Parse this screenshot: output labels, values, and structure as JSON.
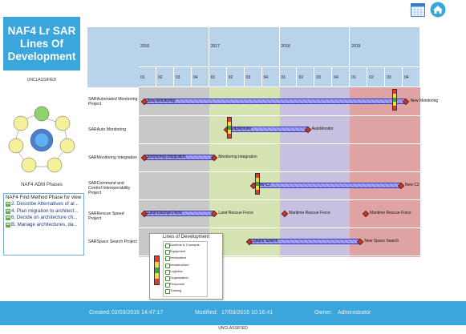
{
  "header": {
    "title_lines": [
      "NAF4 Lr SAR",
      "Lines Of",
      "Development"
    ],
    "classification": "UNCLASSIFIED",
    "icons": [
      "calendar-icon",
      "home-icon"
    ]
  },
  "adm": {
    "caption": "NAF4 ADM Phases"
  },
  "phase_list": {
    "title": "NAF4 Find Method Phase for view",
    "items": [
      "2. Describe Alternatives of ar...",
      "4. Plan migration to architect...",
      "6. Decide on architecture ch...",
      "B. Manage architectures, da..."
    ]
  },
  "timeline": {
    "years": [
      "2016",
      "2017",
      "2018",
      "2019"
    ],
    "quarters": [
      "01",
      "02",
      "03",
      "04",
      "01",
      "02",
      "03",
      "04",
      "01",
      "02",
      "03",
      "04",
      "01",
      "02",
      "03",
      "04"
    ],
    "rows": [
      {
        "label": "SARAutomated Monitoring Project"
      },
      {
        "label": "SARAuto Monitoring"
      },
      {
        "label": "SARMonitoring Integration"
      },
      {
        "label": "SARCommand and Control Interoperability Project"
      },
      {
        "label": "SARRescue Speed Project"
      },
      {
        "label": "SARSpace Search Project"
      }
    ],
    "bars": [
      {
        "label": "New Monitoring",
        "end_label": "New Monitoring"
      },
      {
        "label": "AutoMonitor",
        "end_label": "AutoMonitor"
      },
      {
        "label": "Monitoring Integration",
        "end_label": "Monitoring Integration"
      },
      {
        "label": "New C2",
        "end_label": "New C2"
      },
      {
        "label": "Land Rescue Force",
        "end_label": "Land Rescue Force"
      },
      {
        "label": "Maritime Rescue Force",
        "end_label": "Maritime Rescue Force"
      },
      {
        "label": "Space Search",
        "end_label": "New Space Search"
      }
    ],
    "band_colors": {
      "y2016": "#c8c8c8",
      "y2017": "#d6e4b4",
      "y2018": "#c8c0e0",
      "y2019": "#e0a3a3"
    }
  },
  "legend": {
    "title": "Lines of Development",
    "items": [
      "Doctrine & Concepts",
      "Equipment",
      "Information",
      "Infrastructure",
      "Logistics",
      "Organisation",
      "Personnel",
      "Training"
    ]
  },
  "footer": {
    "created_label": "Created:",
    "created_value": "02/03/2016 14:47:17",
    "modified_label": "Modified:",
    "modified_value": "17/03/2016 10:16:41",
    "owner_label": "Owner:",
    "owner_value": "Administrator",
    "classification": "UNCLASSIFIED"
  }
}
